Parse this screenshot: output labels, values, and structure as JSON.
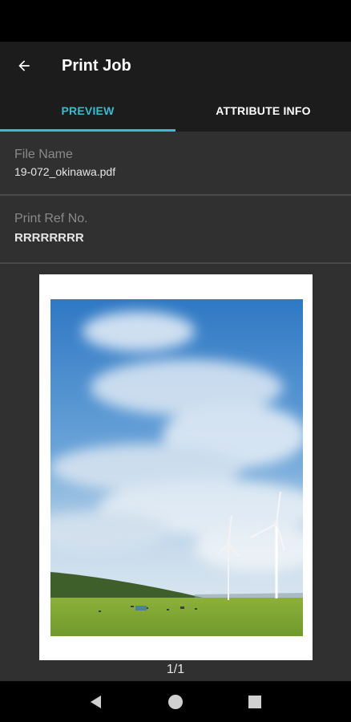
{
  "app_bar": {
    "title": "Print Job",
    "back_icon": "arrow-left-icon"
  },
  "tabs": [
    {
      "label": "PREVIEW",
      "active": true
    },
    {
      "label": "ATTRIBUTE INFO",
      "active": false
    }
  ],
  "file": {
    "label": "File Name",
    "value": "19-072_okinawa.pdf"
  },
  "ref": {
    "label": "Print Ref No.",
    "value": "RRRRRRRR"
  },
  "preview": {
    "page_indicator": "1/1"
  },
  "colors": {
    "accent": "#3fb8d0",
    "app_bar": "#1c1c1c",
    "background": "#303030"
  },
  "nav": {
    "back": "triangle-back-icon",
    "home": "circle-home-icon",
    "recents": "square-recents-icon"
  }
}
